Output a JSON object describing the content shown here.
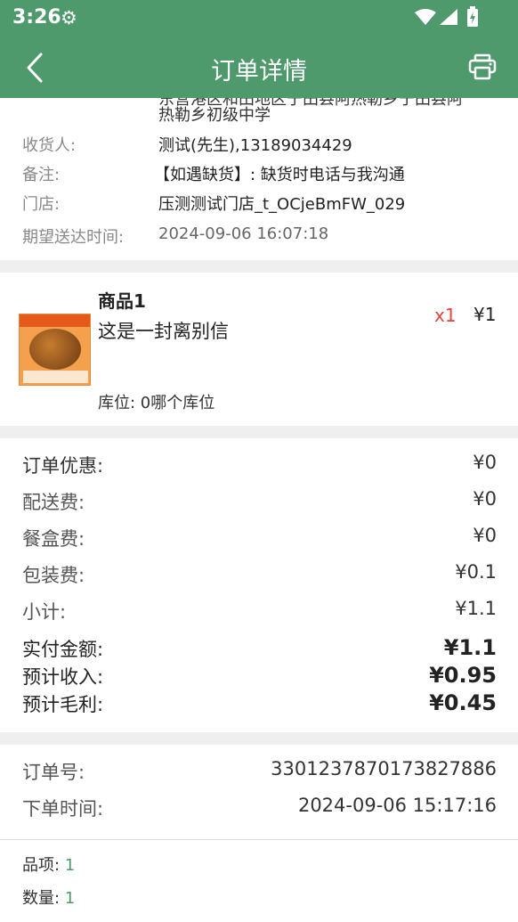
{
  "status_bar": {
    "time": "3:26"
  },
  "app_bar": {
    "title": "订单详情"
  },
  "address": {
    "line1": "东营港区和田地区于田县阿热勒乡于田县阿",
    "line2": "热勒乡初级中学"
  },
  "info": {
    "receiver_label": "收货人:",
    "receiver_value": "测试(先生),13189034429",
    "remark_label": "备注:",
    "remark_value": "【如遇缺货】: 缺货时电话与我沟通",
    "store_label": "门店:",
    "store_value": "压测测试门店_t_OCjeBmFW_029",
    "expected_label": "期望送达时间:",
    "expected_value": "2024-09-06 16:07:18"
  },
  "product": {
    "name": "商品1",
    "desc": "这是一封离别信",
    "stock": "库位: 0哪个库位",
    "qty": "x1",
    "price": "¥1"
  },
  "fees": {
    "discount_label": "订单优惠:",
    "discount_value": "¥0",
    "delivery_label": "配送费:",
    "delivery_value": "¥0",
    "box_label": "餐盒费:",
    "box_value": "¥0",
    "package_label": "包装费:",
    "package_value": "¥0.1",
    "subtotal_label": "小计:",
    "subtotal_value": "¥1.1",
    "paid_label": "实付金额:",
    "paid_value": "¥1.1",
    "income_label": "预计收入:",
    "income_value": "¥0.95",
    "profit_label": "预计毛利:",
    "profit_value": "¥0.45"
  },
  "order": {
    "no_label": "订单号:",
    "no_value": "3301237870173827886",
    "time_label": "下单时间:",
    "time_value": "2024-09-06 15:17:16",
    "items_label": "品项: ",
    "items_value": "1",
    "count_label": "数量: ",
    "count_value": "1"
  },
  "colors": {
    "brand": "#4f9a6d",
    "qty_red": "#e0463a"
  }
}
